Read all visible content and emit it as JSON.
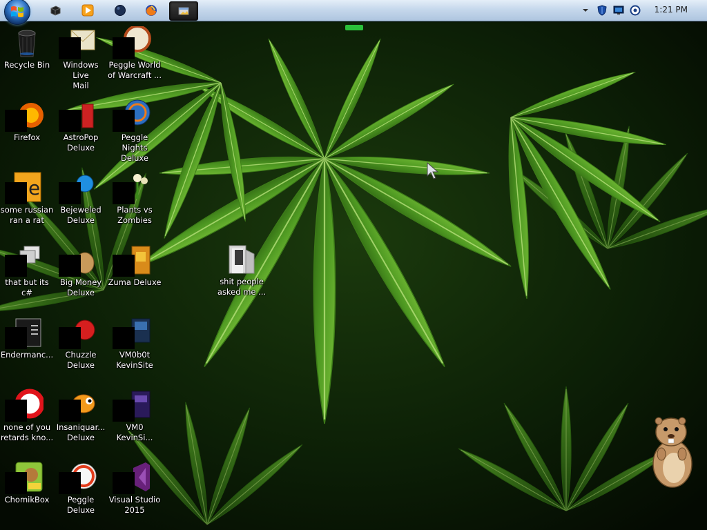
{
  "taskbar": {
    "start_button_icon": "windows-orb-icon",
    "pinned": [
      {
        "name": "black-cube-icon"
      },
      {
        "name": "media-player-icon"
      },
      {
        "name": "ball-icon"
      },
      {
        "name": "firefox-icon"
      },
      {
        "name": "active-window-icon",
        "active": true
      }
    ],
    "tray": {
      "icons": [
        "chevron-up-icon",
        "security-shield-icon",
        "monitor-icon",
        "network-icon"
      ],
      "clock": "1:21 PM"
    }
  },
  "desktop": {
    "icons": [
      {
        "label": "Recycle Bin",
        "icon": "recycle-bin-icon"
      },
      {
        "label": "Windows Live\nMail",
        "icon": "windows-live-mail-icon"
      },
      {
        "label": "Peggle World\nof Warcraft ...",
        "icon": "peggle-world-of-warcraft-icon"
      },
      {
        "label": "Firefox",
        "icon": "firefox-icon"
      },
      {
        "label": "AstroPop\nDeluxe",
        "icon": "astropop-icon"
      },
      {
        "label": "Peggle Nights\nDeluxe",
        "icon": "peggle-nights-icon"
      },
      {
        "label": "some russian\nran a rat",
        "icon": "folder-icon"
      },
      {
        "label": "Bejeweled\nDeluxe",
        "icon": "bejeweled-icon"
      },
      {
        "label": "Plants vs\nZombies",
        "icon": "plants-vs-zombies-icon"
      },
      {
        "label": "that but its c#",
        "icon": "stacked-windows-icon"
      },
      {
        "label": "Big Money\nDeluxe",
        "icon": "big-money-icon"
      },
      {
        "label": "Zuma Deluxe",
        "icon": "zuma-icon"
      },
      {
        "label": "Endermanc...",
        "icon": "console-icon"
      },
      {
        "label": "Chuzzle\nDeluxe",
        "icon": "chuzzle-icon"
      },
      {
        "label": "VM0b0t\nKevinSite",
        "icon": "vm-icon"
      },
      {
        "label": "none of you\nretards kno...",
        "icon": "opera-icon"
      },
      {
        "label": "Insaniquar...\nDeluxe",
        "icon": "insaniquarium-icon"
      },
      {
        "label": "VM0\nKevinSi...",
        "icon": "vm-purple-icon"
      },
      {
        "label": "ChomikBox",
        "icon": "chomikbox-icon"
      },
      {
        "label": "Peggle Deluxe",
        "icon": "peggle-deluxe-icon"
      },
      {
        "label": "Visual Studio\n2015",
        "icon": "visual-studio-icon"
      },
      {
        "label": "shit people\nasked me ...",
        "icon": "folder-icon"
      }
    ]
  },
  "colors": {
    "taskbar_top": "#e4eef8",
    "taskbar_bottom": "#aec5df",
    "leaf_bright": "#5aa826",
    "leaf_dark": "#1f4d0c",
    "label_text": "#ffffff"
  }
}
